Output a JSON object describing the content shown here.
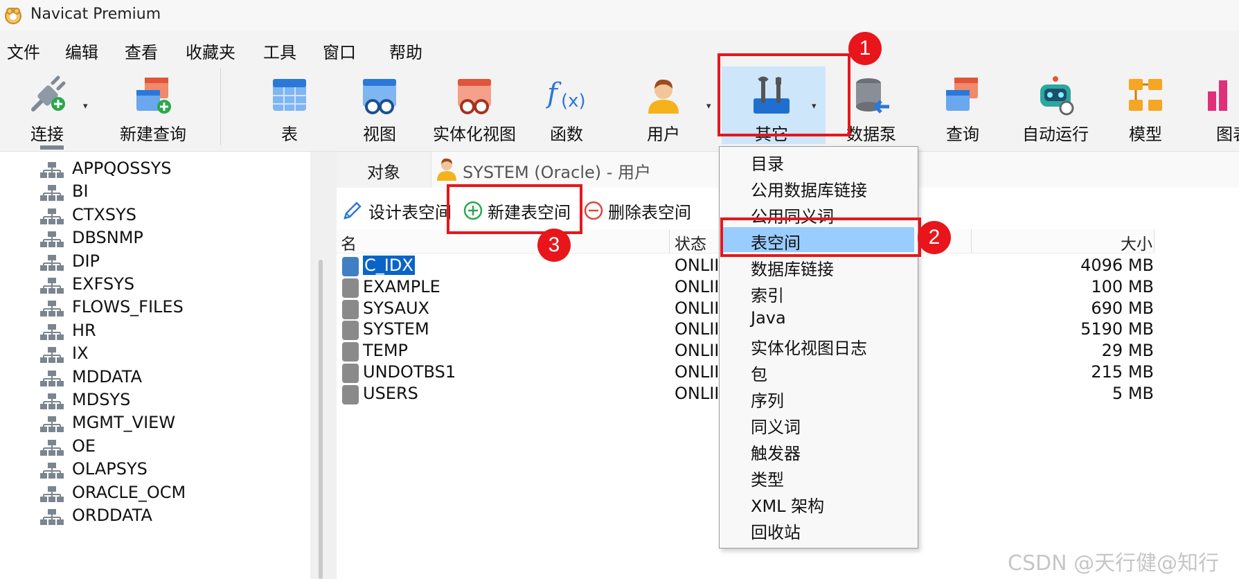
{
  "window": {
    "title": "Navicat Premium"
  },
  "menu": [
    "文件",
    "编辑",
    "查看",
    "收藏夹",
    "工具",
    "窗口",
    "帮助"
  ],
  "toolbar": {
    "connect": "连接",
    "new_query": "新建查询",
    "table": "表",
    "view": "视图",
    "materialized_view": "实体化视图",
    "function": "函数",
    "user": "用户",
    "other": "其它",
    "data_pump": "数据泵",
    "query": "查询",
    "automation": "自动运行",
    "model": "模型",
    "chart": "图表"
  },
  "sidebar": {
    "items": [
      "APPQOSSYS",
      "BI",
      "CTXSYS",
      "DBSNMP",
      "DIP",
      "EXFSYS",
      "FLOWS_FILES",
      "HR",
      "IX",
      "MDDATA",
      "MDSYS",
      "MGMT_VIEW",
      "OE",
      "OLAPSYS",
      "ORACLE_OCM",
      "ORDDATA"
    ]
  },
  "tabs": {
    "objects": "对象",
    "user_tab": "SYSTEM (Oracle) - 用户"
  },
  "actions": {
    "design": "设计表空间",
    "new": "新建表空间",
    "delete": "删除表空间"
  },
  "table": {
    "headers": {
      "name": "名",
      "status": "状态",
      "size": "大小"
    },
    "rows": [
      {
        "name": "C_IDX",
        "status": "ONLII",
        "size": "4096 MB"
      },
      {
        "name": "EXAMPLE",
        "status": "ONLII",
        "size": "100 MB"
      },
      {
        "name": "SYSAUX",
        "status": "ONLII",
        "size": "690 MB"
      },
      {
        "name": "SYSTEM",
        "status": "ONLII",
        "size": "5190 MB"
      },
      {
        "name": "TEMP",
        "status": "ONLII",
        "size": "29 MB"
      },
      {
        "name": "UNDOTBS1",
        "status": "ONLII",
        "size": "215 MB"
      },
      {
        "name": "USERS",
        "status": "ONLII",
        "size": "5 MB"
      }
    ]
  },
  "dropdown": {
    "items": [
      "目录",
      "公用数据库链接",
      "公用同义词",
      "表空间",
      "数据库链接",
      "索引",
      "Java",
      "实体化视图日志",
      "包",
      "序列",
      "同义词",
      "触发器",
      "类型",
      "XML 架构",
      "回收站"
    ],
    "selected": "表空间"
  },
  "annotations": {
    "badge1": "1",
    "badge2": "2",
    "badge3": "3"
  },
  "watermark": "CSDN @天行健@知行",
  "colors": {
    "highlight": "#99ccff",
    "annotation_red": "#e8151b",
    "selection_blue": "#0a64c8"
  }
}
